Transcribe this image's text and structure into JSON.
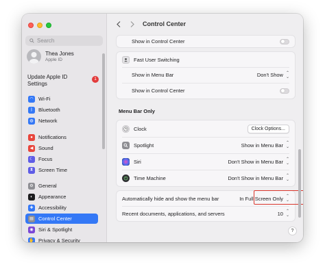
{
  "window": {
    "title": "Control Center"
  },
  "sidebar": {
    "search_placeholder": "Search",
    "profile": {
      "name": "Thea Jones",
      "subtitle": "Apple ID"
    },
    "update": {
      "label": "Update Apple ID Settings",
      "badge": "1"
    },
    "items": [
      {
        "label": "Wi-Fi",
        "icon": "wifi-icon",
        "color": "#3478f6"
      },
      {
        "label": "Bluetooth",
        "icon": "bluetooth-icon",
        "color": "#3478f6"
      },
      {
        "label": "Network",
        "icon": "globe-icon",
        "color": "#3478f6"
      },
      {
        "label": "Notifications",
        "icon": "bell-icon",
        "color": "#e8453c"
      },
      {
        "label": "Sound",
        "icon": "speaker-icon",
        "color": "#e8453c"
      },
      {
        "label": "Focus",
        "icon": "moon-icon",
        "color": "#5e5ce6"
      },
      {
        "label": "Screen Time",
        "icon": "hourglass-icon",
        "color": "#5e5ce6"
      },
      {
        "label": "General",
        "icon": "gear-icon",
        "color": "#8e8e93"
      },
      {
        "label": "Appearance",
        "icon": "appearance-icon",
        "color": "#1d1d1f"
      },
      {
        "label": "Accessibility",
        "icon": "accessibility-icon",
        "color": "#3478f6"
      },
      {
        "label": "Control Center",
        "icon": "control-center-icon",
        "color": "#8e8e93"
      },
      {
        "label": "Siri & Spotlight",
        "icon": "siri-icon",
        "color": "#7a47d6"
      },
      {
        "label": "Privacy & Security",
        "icon": "hand-icon",
        "color": "#3478f6"
      }
    ],
    "active_item": "Control Center"
  },
  "main": {
    "top_card": {
      "show_in_control_center": "Show in Control Center",
      "fast_user_switching": "Fast User Switching",
      "show_in_menu_bar": "Show in Menu Bar",
      "show_in_menu_bar_value": "Don't Show",
      "show_in_control_center_2": "Show in Control Center"
    },
    "menu_bar_only": {
      "title": "Menu Bar Only",
      "clock": {
        "label": "Clock",
        "button": "Clock Options..."
      },
      "spotlight": {
        "label": "Spotlight",
        "value": "Show in Menu Bar"
      },
      "siri": {
        "label": "Siri",
        "value": "Don't Show in Menu Bar"
      },
      "time_machine": {
        "label": "Time Machine",
        "value": "Don't Show in Menu Bar"
      }
    },
    "auto_hide": {
      "label": "Automatically hide and show the menu bar",
      "value": "In Full Screen Only"
    },
    "recent": {
      "label": "Recent documents, applications, and servers",
      "value": "10"
    },
    "help": "?"
  }
}
